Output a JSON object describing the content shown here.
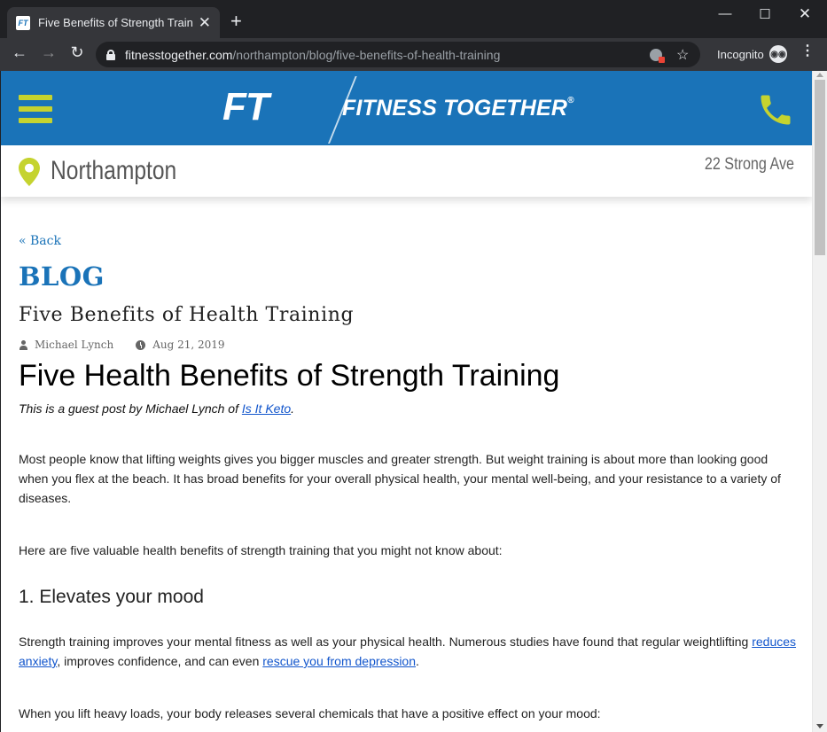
{
  "browser": {
    "tab_title": "Five Benefits of Strength Training",
    "tab_favicon": "FT",
    "url_domain": "fitnesstogether.com",
    "url_path": "/northampton/blog/five-benefits-of-health-training",
    "incognito_label": "Incognito"
  },
  "site": {
    "logo_mark": "FT",
    "logo_text": "FITNESS TOGETHER",
    "logo_reg": "®",
    "brand_blue": "#1a73b8",
    "accent_green": "#c5d32f",
    "location_name": "Northampton",
    "location_address": "22 Strong Ave"
  },
  "post": {
    "back_label": "« Back",
    "section_title": "BLOG",
    "title": "Five Benefits of Health Training",
    "author": "Michael Lynch",
    "date": "Aug 21, 2019",
    "heading": "Five Health Benefits of Strength Training",
    "guest_prefix": "This is a guest post by Michael Lynch of ",
    "guest_link": "Is It Keto",
    "guest_suffix": ".",
    "p1": "Most people know that lifting weights gives you bigger muscles and greater strength. But weight training is about more than looking good when you flex at the beach. It has broad benefits for your overall physical health, your mental well-being, and your resistance to a variety of diseases.",
    "p2": "Here are five valuable health benefits of strength training that you might not know about:",
    "h_mood": "1. Elevates your mood",
    "p3_a": "Strength training improves your mental fitness as well as your physical health. Numerous studies have found that regular weightlifting ",
    "p3_link1": "reduces anxiety",
    "p3_b": ", improves confidence, and can even ",
    "p3_link2": "rescue you from depression",
    "p3_c": ".",
    "p4": "When you lift heavy loads, your body releases several chemicals that have a positive effect on your mood:"
  }
}
